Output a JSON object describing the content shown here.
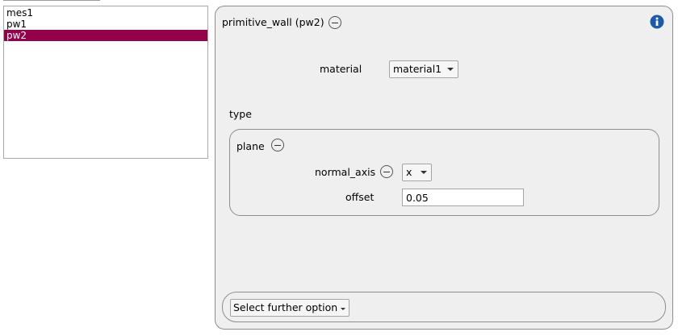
{
  "object_list": {
    "items": [
      {
        "label": "mes1",
        "selected": false
      },
      {
        "label": "pw1",
        "selected": false
      },
      {
        "label": "pw2",
        "selected": true
      }
    ]
  },
  "panel": {
    "title": "primitive_wall (pw2)",
    "material": {
      "label": "material",
      "value": "material1"
    },
    "type_label": "type",
    "plane": {
      "title": "plane",
      "normal_axis": {
        "label": "normal_axis",
        "value": "x"
      },
      "offset": {
        "label": "offset",
        "value": "0.05"
      }
    },
    "further_option_label": "Select further option"
  },
  "colors": {
    "selection": "#94004a",
    "info_icon": "#1c5aa8",
    "panel_bg": "#efefef"
  },
  "icons": [
    "minus-circle-icon",
    "info-icon",
    "dropdown-arrow-icon"
  ]
}
